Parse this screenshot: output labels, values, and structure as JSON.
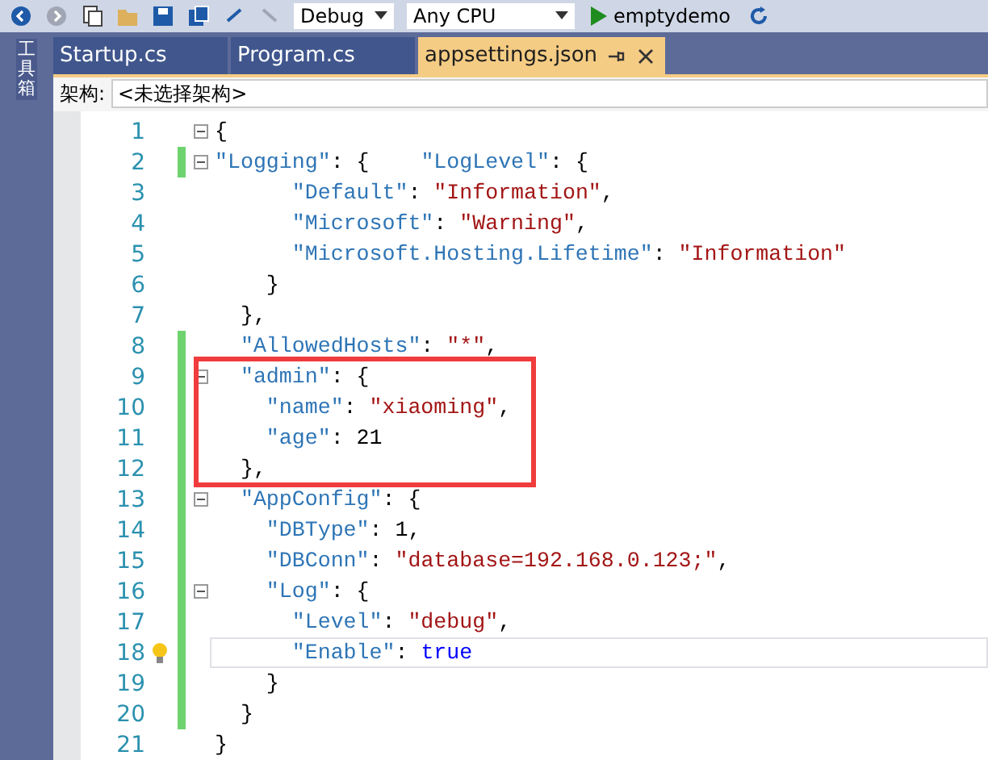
{
  "toolbar": {
    "configuration": "Debug",
    "platform": "Any CPU",
    "run_target": "emptydemo"
  },
  "side_panel": {
    "label": "工具箱"
  },
  "tabs": [
    {
      "label": "Startup.cs",
      "selected": false
    },
    {
      "label": "Program.cs",
      "selected": false
    },
    {
      "label": "appsettings.json",
      "selected": true
    }
  ],
  "nav_bar": {
    "label": "架构:",
    "value": "<未选择架构>"
  },
  "code_blocks": [
    {
      "boxed": false,
      "lines": [
        {
          "number": "1",
          "changed": false,
          "fold": true,
          "hint": false,
          "current": false,
          "tokens": [
            {
              "kind": "punct",
              "text": "{"
            }
          ]
        },
        {
          "number": "2",
          "changed": true,
          "fold": true,
          "hint": false,
          "current": false,
          "tokens": [
            {
              "kind": "key",
              "text": "\"Logging\""
            },
            {
              "kind": "punct",
              "text": ": {    "
            },
            {
              "kind": "key",
              "text": "\"LogLevel\""
            },
            {
              "kind": "punct",
              "text": ": {"
            }
          ]
        },
        {
          "number": "3",
          "changed": false,
          "fold": false,
          "hint": false,
          "current": false,
          "tokens": [
            {
              "kind": "key",
              "text": "      \"Default\""
            },
            {
              "kind": "punct",
              "text": ": "
            },
            {
              "kind": "string",
              "text": "\"Information\""
            },
            {
              "kind": "punct",
              "text": ","
            }
          ]
        },
        {
          "number": "4",
          "changed": false,
          "fold": false,
          "hint": false,
          "current": false,
          "tokens": [
            {
              "kind": "key",
              "text": "      \"Microsoft\""
            },
            {
              "kind": "punct",
              "text": ": "
            },
            {
              "kind": "string",
              "text": "\"Warning\""
            },
            {
              "kind": "punct",
              "text": ","
            }
          ]
        },
        {
          "number": "5",
          "changed": false,
          "fold": false,
          "hint": false,
          "current": false,
          "tokens": [
            {
              "kind": "key",
              "text": "      \"Microsoft.Hosting.Lifetime\""
            },
            {
              "kind": "punct",
              "text": ": "
            },
            {
              "kind": "string",
              "text": "\"Information\""
            }
          ]
        },
        {
          "number": "6",
          "changed": false,
          "fold": false,
          "hint": false,
          "current": false,
          "tokens": [
            {
              "kind": "punct",
              "text": "    }"
            }
          ]
        },
        {
          "number": "7",
          "changed": false,
          "fold": false,
          "hint": false,
          "current": false,
          "tokens": [
            {
              "kind": "punct",
              "text": "  },"
            }
          ]
        },
        {
          "number": "8",
          "changed": true,
          "fold": false,
          "hint": false,
          "current": false,
          "tokens": [
            {
              "kind": "key",
              "text": "  \"AllowedHosts\""
            },
            {
              "kind": "punct",
              "text": ": "
            },
            {
              "kind": "string",
              "text": "\"*\""
            },
            {
              "kind": "punct",
              "text": ","
            }
          ]
        }
      ]
    },
    {
      "boxed": true,
      "lines": [
        {
          "number": "9",
          "changed": true,
          "fold": true,
          "hint": false,
          "current": false,
          "tokens": [
            {
              "kind": "key",
              "text": "  \"admin\""
            },
            {
              "kind": "punct",
              "text": ": {"
            }
          ]
        },
        {
          "number": "10",
          "changed": true,
          "fold": false,
          "hint": false,
          "current": false,
          "tokens": [
            {
              "kind": "key",
              "text": "    \"name\""
            },
            {
              "kind": "punct",
              "text": ": "
            },
            {
              "kind": "string",
              "text": "\"xiaoming\""
            },
            {
              "kind": "punct",
              "text": ","
            }
          ]
        },
        {
          "number": "11",
          "changed": true,
          "fold": false,
          "hint": false,
          "current": false,
          "tokens": [
            {
              "kind": "key",
              "text": "    \"age\""
            },
            {
              "kind": "punct",
              "text": ": "
            },
            {
              "kind": "number",
              "text": "21"
            }
          ]
        },
        {
          "number": "12",
          "changed": true,
          "fold": false,
          "hint": false,
          "current": false,
          "tokens": [
            {
              "kind": "punct",
              "text": "  },"
            }
          ]
        }
      ]
    },
    {
      "boxed": false,
      "lines": [
        {
          "number": "13",
          "changed": true,
          "fold": true,
          "hint": false,
          "current": false,
          "tokens": [
            {
              "kind": "key",
              "text": "  \"AppConfig\""
            },
            {
              "kind": "punct",
              "text": ": {"
            }
          ]
        },
        {
          "number": "14",
          "changed": true,
          "fold": false,
          "hint": false,
          "current": false,
          "tokens": [
            {
              "kind": "key",
              "text": "    \"DBType\""
            },
            {
              "kind": "punct",
              "text": ": "
            },
            {
              "kind": "number",
              "text": "1"
            },
            {
              "kind": "punct",
              "text": ","
            }
          ]
        },
        {
          "number": "15",
          "changed": true,
          "fold": false,
          "hint": false,
          "current": false,
          "tokens": [
            {
              "kind": "key",
              "text": "    \"DBConn\""
            },
            {
              "kind": "punct",
              "text": ": "
            },
            {
              "kind": "string",
              "text": "\"database=192.168.0.123;\""
            },
            {
              "kind": "punct",
              "text": ","
            }
          ]
        },
        {
          "number": "16",
          "changed": true,
          "fold": true,
          "hint": false,
          "current": false,
          "tokens": [
            {
              "kind": "key",
              "text": "    \"Log\""
            },
            {
              "kind": "punct",
              "text": ": {"
            }
          ]
        },
        {
          "number": "17",
          "changed": true,
          "fold": false,
          "hint": false,
          "current": false,
          "tokens": [
            {
              "kind": "key",
              "text": "      \"Level\""
            },
            {
              "kind": "punct",
              "text": ": "
            },
            {
              "kind": "string",
              "text": "\"debug\""
            },
            {
              "kind": "punct",
              "text": ","
            }
          ]
        },
        {
          "number": "18",
          "changed": true,
          "fold": false,
          "hint": true,
          "current": true,
          "tokens": [
            {
              "kind": "key",
              "text": "      \"Enable\""
            },
            {
              "kind": "punct",
              "text": ": "
            },
            {
              "kind": "keyword",
              "text": "true"
            }
          ]
        },
        {
          "number": "19",
          "changed": true,
          "fold": false,
          "hint": false,
          "current": false,
          "tokens": [
            {
              "kind": "punct",
              "text": "    }"
            }
          ]
        },
        {
          "number": "20",
          "changed": true,
          "fold": false,
          "hint": false,
          "current": false,
          "tokens": [
            {
              "kind": "punct",
              "text": "  }"
            }
          ]
        },
        {
          "number": "21",
          "changed": false,
          "fold": false,
          "hint": false,
          "current": false,
          "tokens": [
            {
              "kind": "punct",
              "text": "}"
            }
          ]
        }
      ]
    }
  ]
}
